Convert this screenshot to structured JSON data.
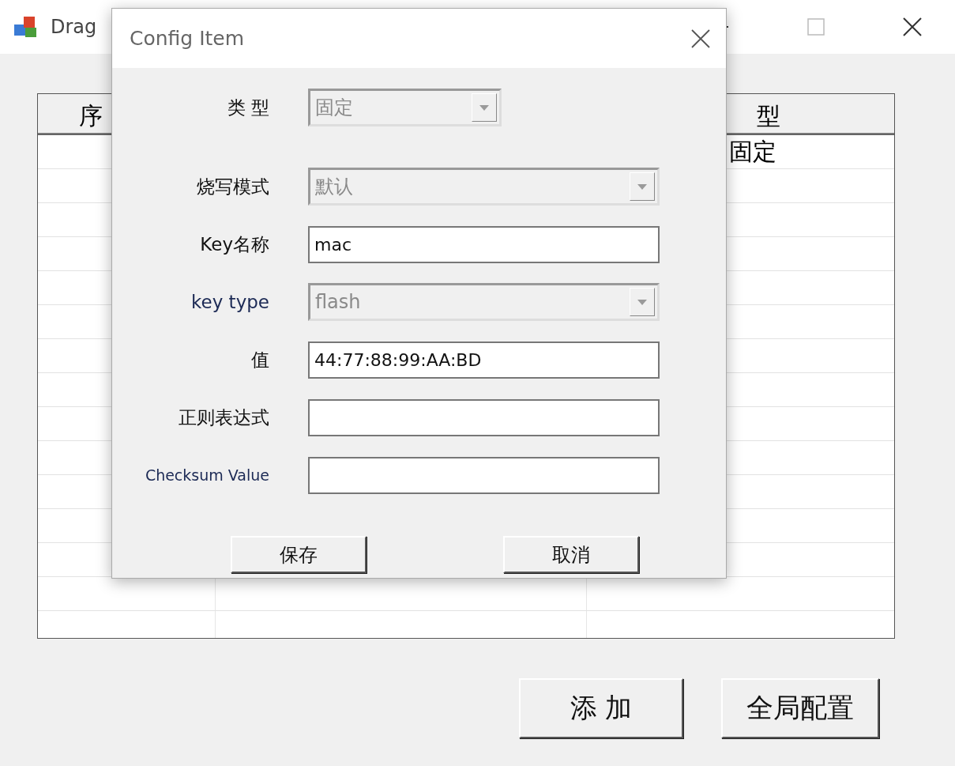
{
  "window": {
    "title": "Drag"
  },
  "table": {
    "columns": [
      "序",
      "",
      "型"
    ],
    "rows": [
      {
        "column_3": "固定"
      }
    ]
  },
  "buttons": [
    "添 加",
    "全局配置"
  ],
  "dialog": {
    "title": "Config Item",
    "fields": [
      {
        "kind": "combo",
        "label": "类 型",
        "value": "固定",
        "disabled": true,
        "narrow": true
      },
      {
        "kind": "combo",
        "label": "烧写模式",
        "value": "默认",
        "disabled": true
      },
      {
        "kind": "text",
        "label": "Key名称",
        "value": "mac",
        "disabled": false
      },
      {
        "kind": "combo",
        "label": "key type",
        "value": "flash",
        "disabled": true
      },
      {
        "kind": "text",
        "label": "值",
        "value": "44:77:88:99:AA:BD",
        "disabled": false
      },
      {
        "kind": "text",
        "label": "正则表达式",
        "disabled": false
      },
      {
        "kind": "text",
        "label": "Checksum Value",
        "disabled": false
      }
    ],
    "buttons": [
      "保存",
      "取消"
    ]
  }
}
